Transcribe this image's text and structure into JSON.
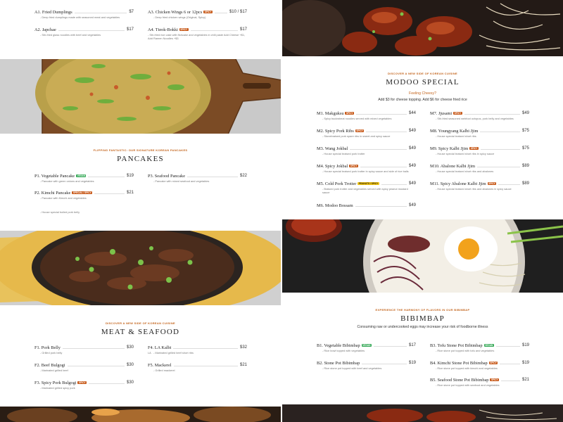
{
  "colors": {
    "accent": "#c4661f",
    "spicy_badge": "#c85a1a",
    "vegan_badge": "#35a957",
    "peanuts_badge": "#f1c617"
  },
  "badges": {
    "spicy": "SPICY",
    "vegan": "VEGAN",
    "special_spicy": "SPECIAL / SPICY",
    "peanuts_spicy": "PEANUTS / SPICY"
  },
  "appetizers": {
    "a1": {
      "name": "A1. Fried Dumplings",
      "price": "$7",
      "desc": "- Deep fried dumplings made with seasoned meat and vegetables"
    },
    "a2": {
      "name": "A2. Japchae",
      "price": "$17",
      "desc": "- Stir-fried glass noodles with beef and vegetables"
    },
    "a3": {
      "name": "A3. Chicken Wings 6 or 12pcs",
      "price": "$10 / $17",
      "desc": "- Deep fried chicken wings (Original, Spicy)"
    },
    "a4": {
      "name": "A4. Tteok-Bokki",
      "price": "$17",
      "desc": "- Stir-fried rice cake with fishcake and vegetables in chili paste Add Cheese +$1, Add Ramen Noodles +$3"
    }
  },
  "pancakes": {
    "kicker": "Flipping Fantastic: Our Signature Korean Pancakes",
    "title": "PANCAKES",
    "p1": {
      "name": "P1. Vegetable Pancake",
      "price": "$19",
      "desc": "- Pancake with green onions and vegetables"
    },
    "p2": {
      "name": "P2. Kimchi Pancake",
      "price": "$21",
      "desc": "- Pancake with Kimchi and vegetables"
    },
    "p3": {
      "name": "P3. Seafood Pancake",
      "price": "$22",
      "desc": "- Pancake with mixed seafood and vegetables"
    },
    "extra_desc": "- House special boiled pork belly"
  },
  "meat": {
    "kicker": "Discover a new side of Korean cuisine",
    "title": "MEAT & SEAFOOD",
    "f1": {
      "name": "F1. Pork Belly",
      "price": "$30",
      "desc": "- Grilled pork belly"
    },
    "f2": {
      "name": "F2. Beef Bulgogi",
      "price": "$30",
      "desc": "- Marinated grilled beef"
    },
    "f3": {
      "name": "F3. Spicy Pork Bulgogi",
      "price": "$30",
      "desc": "- Marinated grilled spicy pork"
    },
    "f4": {
      "name": "F4. LA Kalbi",
      "price": "$32",
      "label": "LA",
      "desc": "- Marinated grilled beef short ribs"
    },
    "f5": {
      "name": "F5. Mackerel",
      "price": "$21",
      "desc": "- Grilled mackerel"
    }
  },
  "modoo": {
    "kicker": "Discover a new side of Korean cuisine",
    "title": "MODOO SPECIAL",
    "feeling": "Feeling Cheesy?",
    "cheese_note": "Add $3 for cheese topping. Add $6 for cheese fried rice",
    "m1": {
      "name": "M1. Makguksu",
      "price": "$44",
      "desc": "- Spicy buckwheat noodles served with mixed vegetables"
    },
    "m2": {
      "name": "M2. Spicy Pork Ribs",
      "price": "$49",
      "desc": "- Stonebraised pork spare ribs in sweet and spicy sauce"
    },
    "m3": {
      "name": "M3. Wang Jokbal",
      "price": "$49",
      "desc": "- House special braised pork trotter"
    },
    "m4": {
      "name": "M4. Spicy Jokbal",
      "price": "$49",
      "desc": "- House special braised pork trotter in spicy sauce and side of rice balls"
    },
    "m5": {
      "name": "M5. Cold Pork Trotter",
      "price": "$49",
      "desc": "- Braised pork trotter and vegetables served with spicy peanut mustard sauce"
    },
    "m6": {
      "name": "M6. Modoo Bossam",
      "price": "$49"
    },
    "m7": {
      "name": "M7. Jjusami",
      "price": "$49",
      "desc": "- Stir-fried seasoned webfoot octopus, pork belly and vegetables"
    },
    "m8": {
      "name": "M8. Youngyang Kalbi Jjim",
      "price": "$75",
      "desc": "- House special braised short ribs"
    },
    "m9": {
      "name": "M9. Spicy Kalbi Jjim",
      "price": "$75",
      "desc": "- House special braised short ribs in spicy sauce"
    },
    "m10": {
      "name": "M10. Abalone Kalbi Jjim",
      "price": "$89",
      "desc": "- House special braised short ribs and abalones"
    },
    "m11": {
      "name": "M11. Spicy Abalone Kalbi Jjim",
      "price": "$89",
      "desc": "- House special braised short ribs and abalones in spicy sauce"
    }
  },
  "bibimbap": {
    "kicker": "Experience the harmony of flavors in our Bibimbap",
    "title": "BIBIMBAP",
    "warning": "Consuming raw or undercooked eggs may increase your risk of foodborne illness",
    "b1": {
      "name": "B1. Vegetable Bibimbap",
      "price": "$17",
      "desc": "- Rice bowl topped with vegetables"
    },
    "b2": {
      "name": "B2. Stone Pot Bibimbap",
      "price": "$19",
      "desc": "- Rice stone pot topped with beef and vegetables"
    },
    "b3": {
      "name": "B3. Tofu Stone Pot Bibimbap",
      "price": "$19",
      "desc": "- Rice stone pot topped with tofu and vegetables"
    },
    "b4": {
      "name": "B4. Kimchi Stone Pot Bibimbap",
      "price": "$19",
      "desc": "- Rice stone pot topped with kimchi and vegetables"
    },
    "b5": {
      "name": "B5. Seafood Stone Pot Bibimbap",
      "price": "$21",
      "desc": "- Rice stone pot topped with seafood and vegetables"
    }
  }
}
